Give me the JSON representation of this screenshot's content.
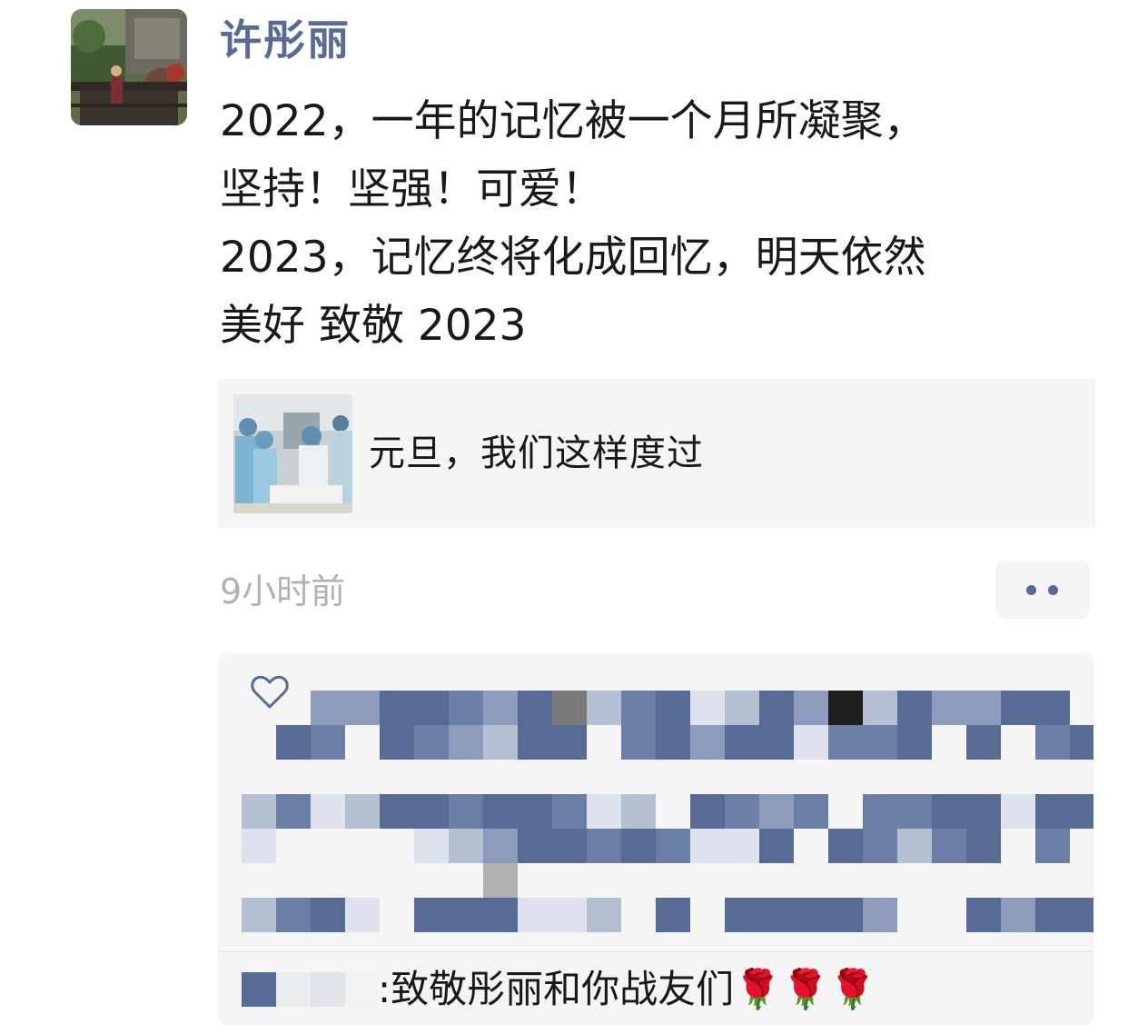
{
  "post": {
    "author": "许彤丽",
    "text_lines": [
      "2022，一年的记忆被一个月所凝聚，",
      "坚持！坚强！可爱！",
      "2023，记忆终将化成回忆，明天依然",
      "美好 致敬 2023"
    ],
    "link_card": {
      "title": "元旦，我们这样度过"
    },
    "timestamp": "9小时前"
  },
  "interactions": {
    "comment": {
      "separator": ":",
      "text": "致敬彤丽和你战友们🌹🌹🌹"
    }
  },
  "icons": {
    "like": "heart-icon",
    "more": "more-dots-icon"
  },
  "colors": {
    "name_link": "#576b95",
    "timestamp": "#b2b2b2",
    "panel_bg": "#f5f5f5"
  }
}
